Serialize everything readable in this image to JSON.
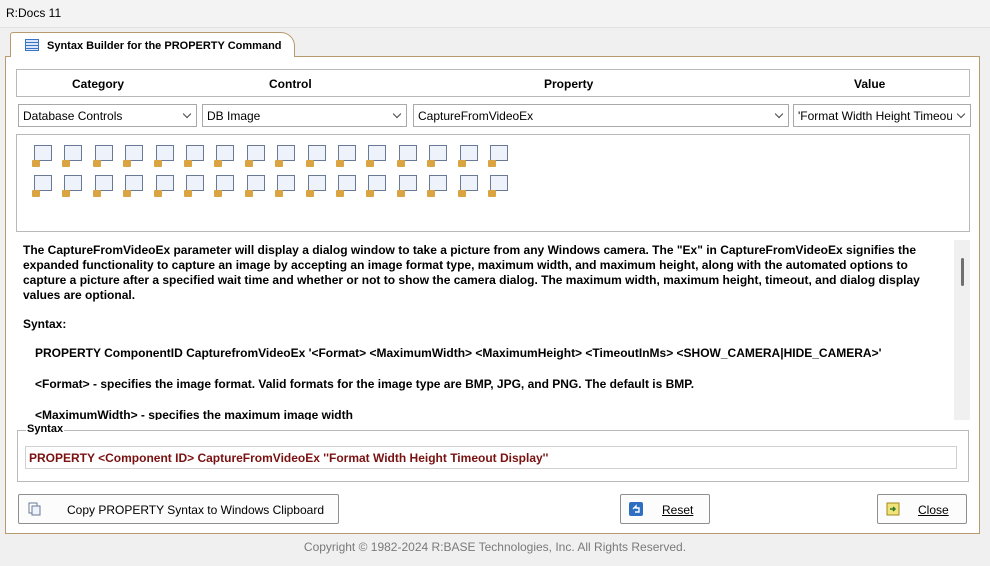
{
  "window": {
    "title": "R:Docs 11"
  },
  "tab": {
    "label": "Syntax Builder for the PROPERTY Command"
  },
  "headers": {
    "category": "Category",
    "control": "Control",
    "property": "Property",
    "value": "Value"
  },
  "selects": {
    "category": "Database Controls",
    "control": "DB Image",
    "property": "CaptureFromVideoEx",
    "value": "'Format Width Height Timeout Display'"
  },
  "toolbox_icons": [
    "db-label-icon",
    "db-edit-icon",
    "db-memo-icon",
    "db-globe-icon",
    "db-rich-text-icon",
    "db-image-icon",
    "db-checkbox-icon",
    "db-radio-icon",
    "db-listbox-icon",
    "db-lookup-icon",
    "db-spin-icon",
    "db-combo-icon",
    "db-grid-icon",
    "db-tree-icon",
    "db-list-icon",
    "db-form-icon",
    "db-navigator-icon",
    "db-table-icon",
    "db-home-icon",
    "db-richtext-add-icon",
    "db-datetime-icon",
    "db-calc-icon",
    "db-spin-edit-icon",
    "db-grid-view-icon",
    "db-chart-icon",
    "db-gauge-icon",
    "db-tree-nodes-icon",
    "db-dial-icon",
    "db-layout-icon",
    "db-browse-icon",
    "db-columns-icon",
    "db-sum-icon"
  ],
  "description": {
    "para1": "The CaptureFromVideoEx parameter will display a dialog window to take a picture from any Windows camera. The \"Ex\" in CaptureFromVideoEx signifies the expanded functionality to capture an image by accepting an image format type, maximum width, and maximum height, along with the automated options to capture a picture after a specified wait time and whether or not to show the camera dialog. The maximum width, maximum height, timeout, and dialog display values are optional.",
    "syntax_heading": "Syntax:",
    "syntax_line": "PROPERTY ComponentID CapturefromVideoEx '<Format> <MaximumWidth> <MaximumHeight> <TimeoutInMs> <SHOW_CAMERA|HIDE_CAMERA>'",
    "format_line": "<Format> - specifies the image format. Valid formats for the image type are BMP, JPG, and PNG. The default is BMP.",
    "maxwidth_line": "<MaximumWidth> - specifies the maximum image width"
  },
  "syntax_box": {
    "legend": "Syntax",
    "value": "PROPERTY <Component ID> CaptureFromVideoEx ''Format Width Height Timeout Display''"
  },
  "buttons": {
    "copy": "Copy PROPERTY Syntax to Windows Clipboard",
    "reset": "Reset",
    "close": "Close"
  },
  "footer": {
    "copyright": "Copyright © 1982-2024 R:BASE Technologies, Inc. All Rights Reserved."
  },
  "colors": {
    "accent_border": "#b79b6e",
    "syntax_text": "#7a1111"
  }
}
